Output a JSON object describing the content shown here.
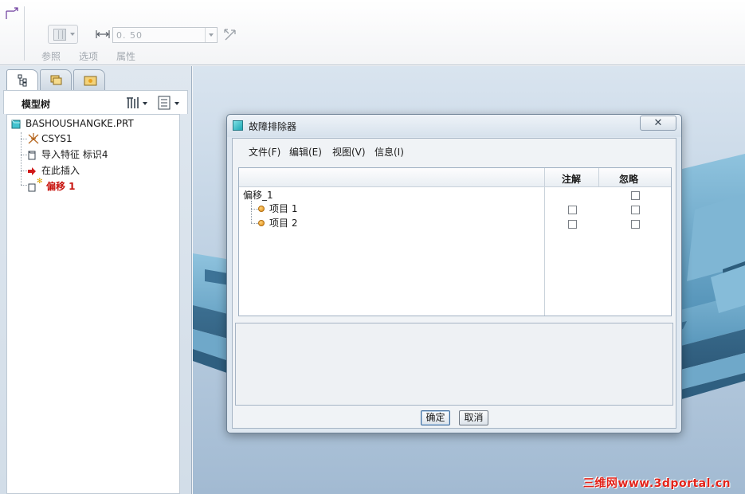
{
  "ribbon": {
    "thickness_value": "0. 50",
    "tabs": [
      "参照",
      "选项",
      "属性"
    ]
  },
  "model_tree": {
    "title": "模型树",
    "items": [
      {
        "label": "BASHOUSHANGKE.PRT",
        "icon": "part-icon"
      },
      {
        "label": "CSYS1",
        "icon": "csys-icon"
      },
      {
        "label": "导入特征 标识4",
        "icon": "import-feature-icon"
      },
      {
        "label": "在此插入",
        "icon": "insert-here-arrow-icon"
      },
      {
        "label": "偏移 1",
        "icon": "offset-feature-icon",
        "color": "#c8140f"
      }
    ]
  },
  "dialog": {
    "title": "故障排除器",
    "close_glyph": "✕",
    "menu": [
      "文件(F)",
      "编辑(E)",
      "视图(V)",
      "信息(I)"
    ],
    "columns": {
      "note": "注解",
      "ignore": "忽略"
    },
    "rows": [
      {
        "label": "偏移_1",
        "level": 0,
        "note_checkbox": false,
        "note_checked": false,
        "ignore_checked": false
      },
      {
        "label": "项目 1",
        "level": 1,
        "note_checkbox": true,
        "note_checked": false,
        "ignore_checked": false
      },
      {
        "label": "项目 2",
        "level": 1,
        "note_checkbox": true,
        "note_checked": false,
        "ignore_checked": false
      }
    ],
    "ok_label": "确定",
    "cancel_label": "取消"
  },
  "watermark": "三维网www.3dportal.cn",
  "colors": {
    "accent_red": "#c8140f",
    "viewport_bg": "#b9cde0",
    "model_blue": "#5f96b8"
  }
}
